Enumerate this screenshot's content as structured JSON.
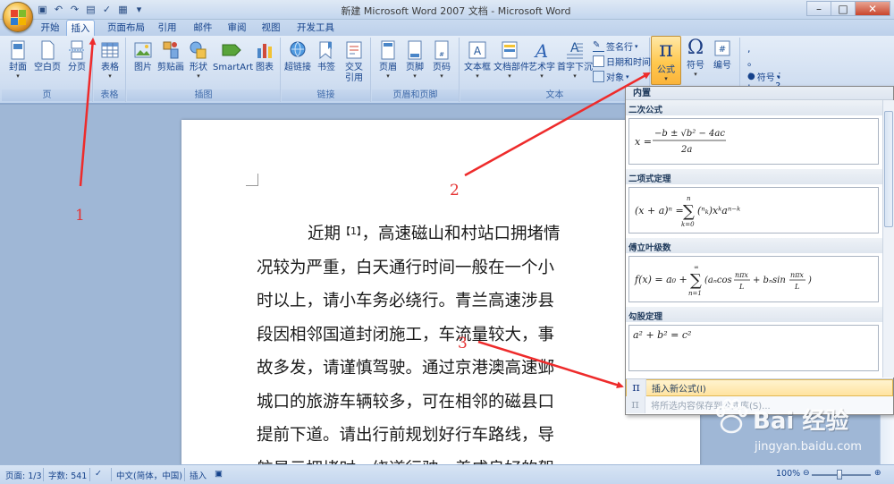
{
  "window": {
    "title": "新建 Microsoft Word 2007 文档 - Microsoft Word",
    "controls": [
      "–",
      "□",
      "✕"
    ]
  },
  "quick_access": [
    "save-icon",
    "undo-icon",
    "redo-icon",
    "print-preview-icon",
    "spelling-icon",
    "format-icon"
  ],
  "tabs": [
    {
      "label": "开始",
      "active": false
    },
    {
      "label": "插入",
      "active": true
    },
    {
      "label": "页面布局",
      "active": false
    },
    {
      "label": "引用",
      "active": false
    },
    {
      "label": "邮件",
      "active": false
    },
    {
      "label": "审阅",
      "active": false
    },
    {
      "label": "视图",
      "active": false
    },
    {
      "label": "开发工具",
      "active": false
    }
  ],
  "ribbon": {
    "groups": {
      "pages": "页",
      "tables": "表格",
      "illustrations": "插图",
      "links": "链接",
      "header_footer": "页眉和页脚",
      "text": "文本"
    },
    "buttons": {
      "cover": "封面",
      "blank": "空白页",
      "break": "分页",
      "table": "表格",
      "picture": "图片",
      "clipart": "剪贴画",
      "shapes": "形状",
      "smartart": "SmartArt",
      "chart": "图表",
      "hyperlink": "超链接",
      "bookmark": "书签",
      "crossref_1": "交叉",
      "crossref_2": "引用",
      "header": "页眉",
      "footer": "页脚",
      "pagenum": "页码",
      "textbox": "文本框",
      "quickparts": "文档部件",
      "wordart": "艺术字",
      "dropcap": "首字下沉",
      "signature": "签名行",
      "datetime": "日期和时间",
      "object": "对象",
      "equation": "公式",
      "symbol": "符号",
      "number": "编号",
      "special_symbol": "符号"
    }
  },
  "document": {
    "superscript": "【1】",
    "lines": [
      "，高速磁山和村站口拥堵情",
      "况较为严重，白天通行时间一般在一个小",
      "时以上，请小车务必绕行。青兰高速涉县",
      "段因相邻国道封闭施工，车流量较大，事",
      "故多发，请谨慎驾驶。通过京港澳高速邺",
      "城口的旅游车辆较多，可在相邻的磁县口",
      "提前下道。请出行前规划好行车路线，导",
      "航显示拥堵时，绕道行驶，养成良好的驾"
    ],
    "first_word": "近期"
  },
  "equation_gallery": {
    "header": "内置",
    "items": [
      {
        "name": "二次公式"
      },
      {
        "name": "二项式定理"
      },
      {
        "name": "傅立叶级数"
      },
      {
        "name": "勾股定理",
        "formula": "a² + b² = c²"
      }
    ],
    "menu": [
      {
        "label": "插入新公式(I)",
        "icon": "pi-icon",
        "enabled": true
      },
      {
        "label": "将所选内容保存到公式库(S)...",
        "icon": "save-to-gallery-icon",
        "enabled": false
      }
    ]
  },
  "statusbar": {
    "page": "页面: 1/3",
    "words": "字数: 541",
    "language": "中文(简体，中国)",
    "mode": "插入",
    "zoom": "100%"
  },
  "annotations": {
    "step1": "1",
    "step2": "2",
    "step3": "3"
  },
  "watermark": {
    "brand": "Bai 经验",
    "url": "jingyan.baidu.com"
  }
}
